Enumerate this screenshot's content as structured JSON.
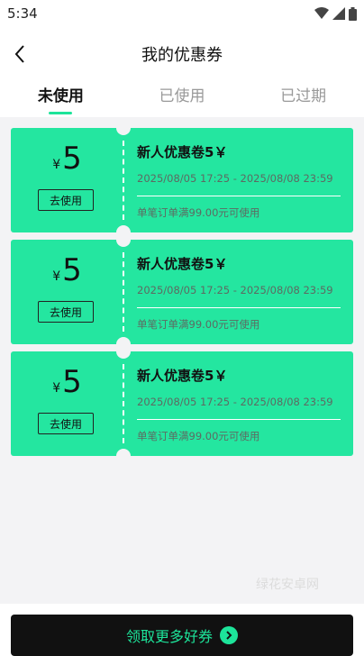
{
  "status_bar": {
    "time": "5:34"
  },
  "header": {
    "title": "我的优惠券"
  },
  "tabs": [
    {
      "label": "未使用",
      "active": true
    },
    {
      "label": "已使用",
      "active": false
    },
    {
      "label": "已过期",
      "active": false
    }
  ],
  "coupons": [
    {
      "currency": "¥",
      "amount": "5",
      "use_label": "去使用",
      "name": "新人优惠卷5￥",
      "period": "2025/08/05 17:25 - 2025/08/08 23:59",
      "rule": "单笔订单满99.00元可使用"
    },
    {
      "currency": "¥",
      "amount": "5",
      "use_label": "去使用",
      "name": "新人优惠卷5￥",
      "period": "2025/08/05 17:25 - 2025/08/08 23:59",
      "rule": "单笔订单满99.00元可使用"
    },
    {
      "currency": "¥",
      "amount": "5",
      "use_label": "去使用",
      "name": "新人优惠卷5￥",
      "period": "2025/08/05 17:25 - 2025/08/08 23:59",
      "rule": "单笔订单满99.00元可使用"
    }
  ],
  "watermark": "绿花安卓网",
  "bottom_button": {
    "label": "领取更多好券"
  },
  "colors": {
    "accent": "#24e6a0",
    "button_bg": "#111111",
    "accent_text": "#1de49a"
  }
}
